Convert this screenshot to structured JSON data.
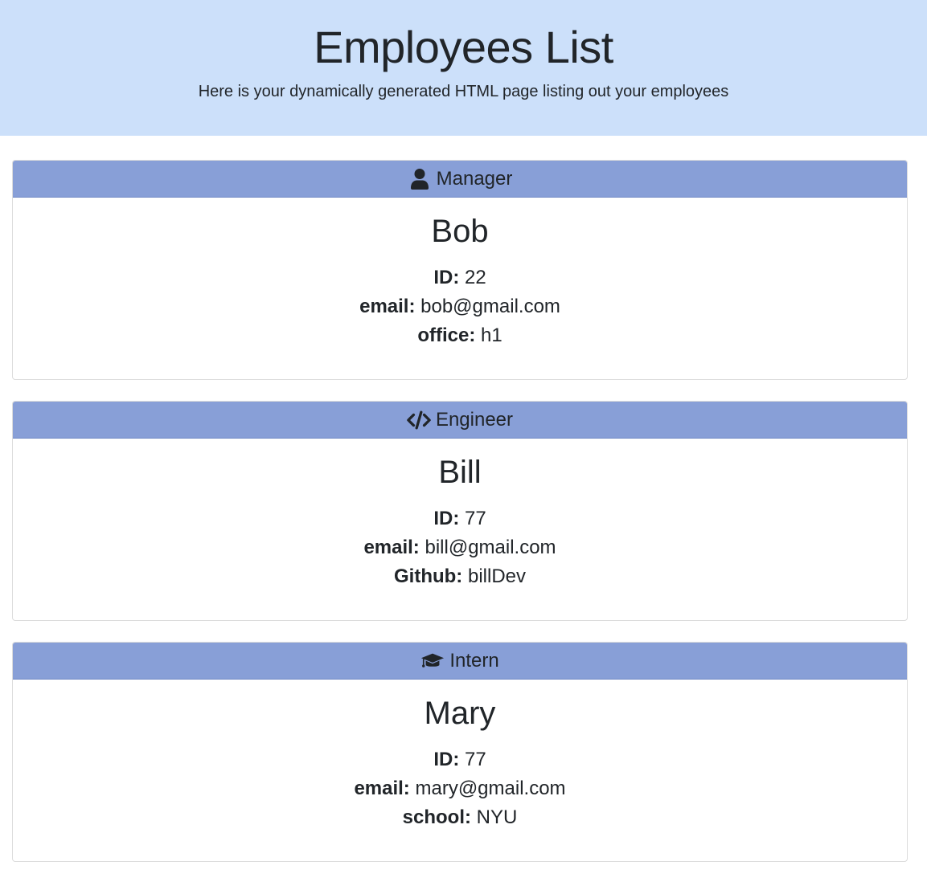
{
  "header": {
    "title": "Employees List",
    "subtitle": "Here is your dynamically generated HTML page listing out your employees"
  },
  "colors": {
    "jumbotron_bg": "#cce0fa",
    "card_header_bg": "#889fd7",
    "text": "#212529"
  },
  "employees": [
    {
      "role": "Manager",
      "icon": "user-icon",
      "name": "Bob",
      "details": [
        {
          "label": "ID:",
          "value": "22"
        },
        {
          "label": "email:",
          "value": "bob@gmail.com"
        },
        {
          "label": "office:",
          "value": "h1"
        }
      ]
    },
    {
      "role": "Engineer",
      "icon": "code-icon",
      "name": "Bill",
      "details": [
        {
          "label": "ID:",
          "value": "77"
        },
        {
          "label": "email:",
          "value": "bill@gmail.com"
        },
        {
          "label": "Github:",
          "value": "billDev"
        }
      ]
    },
    {
      "role": "Intern",
      "icon": "graduation-cap-icon",
      "name": "Mary",
      "details": [
        {
          "label": "ID:",
          "value": "77"
        },
        {
          "label": "email:",
          "value": "mary@gmail.com"
        },
        {
          "label": "school:",
          "value": "NYU"
        }
      ]
    }
  ]
}
